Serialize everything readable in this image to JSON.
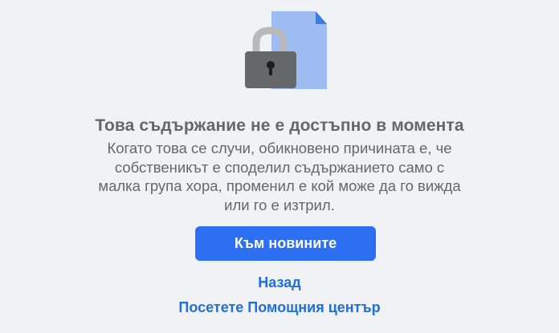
{
  "illustration": {
    "lock_icon": "lock-icon",
    "document_icon": "document-icon",
    "colors": {
      "document": "#9cbcf2",
      "document_fold": "#3b7be8",
      "lock_body": "#65676b",
      "shackle": "#b8b9bd",
      "keyhole": "#1c1e21"
    }
  },
  "message": {
    "title": "Това съдържание не е достъпно в момента",
    "body_lines": [
      "Когато това се случи, обикновено причината е, че",
      "собственикът е споделил съдържанието само с",
      "малка група хора, променил е кой може да го вижда",
      "или го е изтрил."
    ]
  },
  "actions": {
    "news_feed_button": "Към новините",
    "back_link": "Назад",
    "help_center_link": "Посетете Помощния център"
  },
  "colors": {
    "background": "#f0f2f5",
    "primary": "#2d6ff2",
    "link": "#216fdb",
    "text_secondary": "#65676b"
  }
}
